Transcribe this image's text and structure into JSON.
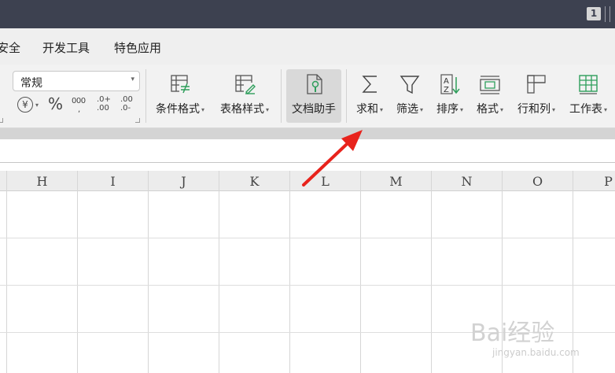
{
  "titlebar": {
    "window_badge": "1"
  },
  "menu": {
    "items": [
      "安全",
      "开发工具",
      "特色应用"
    ]
  },
  "number_format": {
    "selected": "常规",
    "currency_symbol": "¥",
    "percent": "%",
    "thousands": "000",
    "inc_decimal": ".0+\n.00",
    "dec_decimal": ".00\n.0-"
  },
  "tools": {
    "conditional_format": "条件格式",
    "table_style": "表格样式",
    "doc_assistant": "文档助手",
    "sum": "求和",
    "filter": "筛选",
    "sort": "排序",
    "format": "格式",
    "rows_cols": "行和列",
    "worksheet": "工作表"
  },
  "columns": [
    "H",
    "I",
    "J",
    "K",
    "L",
    "M",
    "N",
    "O",
    "P"
  ],
  "watermark": {
    "logo": "Bai经验",
    "url": "jingyan.baidu.com"
  },
  "colors": {
    "titlebar": "#3d4150",
    "arrow": "#e8231c",
    "ribbon": "#f2f2f2",
    "accent_green": "#2e9e5b"
  }
}
